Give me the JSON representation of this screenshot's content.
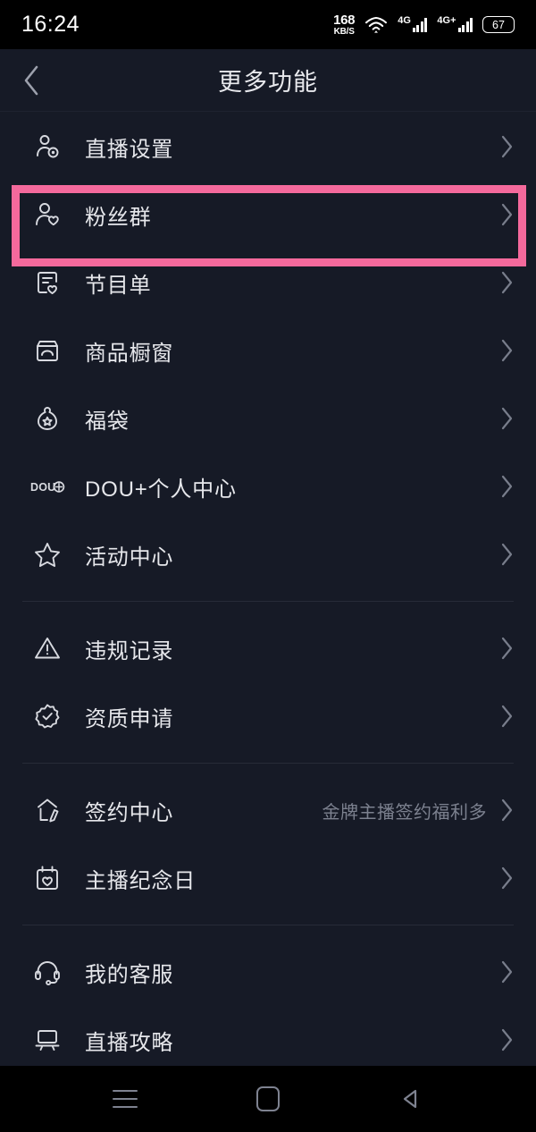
{
  "status_bar": {
    "time": "16:24",
    "net_speed_value": "168",
    "net_speed_unit": "KB/S",
    "wifi_icon": "wifi-icon",
    "signal_1_label": "4G",
    "signal_2_label": "4G+",
    "battery_level": "67"
  },
  "header": {
    "back_icon": "chevron-left-icon",
    "title": "更多功能"
  },
  "highlight": {
    "color": "#F4699C",
    "target_label": "粉丝群"
  },
  "sections": [
    {
      "items": [
        {
          "icon": "person-gear-icon",
          "label": "直播设置",
          "value": "",
          "chevron": "chevron-right-icon"
        },
        {
          "icon": "person-heart-icon",
          "label": "粉丝群",
          "value": "",
          "chevron": "chevron-right-icon"
        },
        {
          "icon": "list-heart-icon",
          "label": "节目单",
          "value": "",
          "chevron": "chevron-right-icon"
        },
        {
          "icon": "storefront-icon",
          "label": "商品橱窗",
          "value": "",
          "chevron": "chevron-right-icon"
        },
        {
          "icon": "lucky-bag-icon",
          "label": "福袋",
          "value": "",
          "chevron": "chevron-right-icon"
        },
        {
          "icon": "dou-plus-icon",
          "label": "DOU+个人中心",
          "value": "",
          "chevron": "chevron-right-icon"
        },
        {
          "icon": "star-icon",
          "label": "活动中心",
          "value": "",
          "chevron": "chevron-right-icon"
        }
      ]
    },
    {
      "items": [
        {
          "icon": "warning-triangle-icon",
          "label": "违规记录",
          "value": "",
          "chevron": "chevron-right-icon"
        },
        {
          "icon": "verified-badge-icon",
          "label": "资质申请",
          "value": "",
          "chevron": "chevron-right-icon"
        }
      ]
    },
    {
      "items": [
        {
          "icon": "contract-sign-icon",
          "label": "签约中心",
          "value": "金牌主播签约福利多",
          "chevron": "chevron-right-icon"
        },
        {
          "icon": "calendar-heart-icon",
          "label": "主播纪念日",
          "value": "",
          "chevron": "chevron-right-icon"
        }
      ]
    },
    {
      "items": [
        {
          "icon": "headset-icon",
          "label": "我的客服",
          "value": "",
          "chevron": "chevron-right-icon"
        },
        {
          "icon": "projector-icon",
          "label": "直播攻略",
          "value": "",
          "chevron": "chevron-right-icon"
        }
      ]
    }
  ],
  "navbar": {
    "recents_icon": "menu-icon",
    "home_icon": "home-square-icon",
    "back_icon": "back-triangle-icon"
  }
}
